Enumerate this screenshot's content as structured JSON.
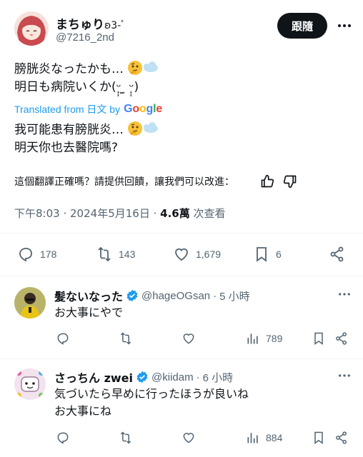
{
  "tweet": {
    "author_name": "まちゅり",
    "author_name_suffix": "ʚ3-ﾟ",
    "handle": "@7216_2nd",
    "follow_label": "跟隨",
    "original_line1": "膀胱炎なったかも…",
    "original_line2": "明日も病院いくか(ᵕ̩̩ ̫ ᵕ̩̩)",
    "translated_prefix": "Translated from 日文 by",
    "google_word": "Google",
    "translated_line1": "我可能患有膀胱炎…",
    "translated_line2": "明天你也去醫院嗎?",
    "feedback_prompt": "這個翻譯正確嗎？請提供回饋，讓我們可以改進：",
    "time": "下午8:03",
    "date": "2024年5月16日",
    "views_count": "4.6萬",
    "views_label": "次查看",
    "stats": {
      "replies": "178",
      "retweets": "143",
      "likes": "1,679",
      "bookmarks": "6"
    }
  },
  "replies": [
    {
      "name": "髪ないなった",
      "handle": "@hageOGsan",
      "age": "5 小時",
      "text_lines": [
        "お大事にやで"
      ],
      "views": "789"
    },
    {
      "name": "さっちん zwei",
      "handle": "@kiidam",
      "age": "6 小時",
      "text_lines": [
        "気づいたら早めに行ったほうが良いね",
        "お大事にね"
      ],
      "views": "884"
    }
  ],
  "colors": {
    "accent": "#1d9bf0",
    "text": "#0f1419",
    "secondary": "#536471",
    "divider": "#eff3f4",
    "verified": "#1d9bf0"
  }
}
